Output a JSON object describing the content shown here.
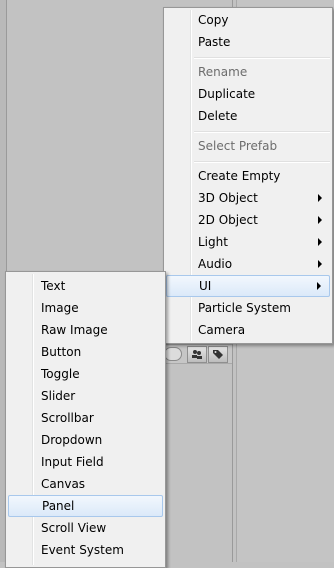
{
  "context_menu": {
    "items": [
      {
        "label": "Copy",
        "enabled": true
      },
      {
        "label": "Paste",
        "enabled": true
      },
      {
        "label": "Rename",
        "enabled": false
      },
      {
        "label": "Duplicate",
        "enabled": true
      },
      {
        "label": "Delete",
        "enabled": true
      },
      {
        "label": "Select Prefab",
        "enabled": false
      },
      {
        "label": "Create Empty",
        "enabled": true
      },
      {
        "label": "3D Object",
        "enabled": true,
        "has_submenu": true
      },
      {
        "label": "2D Object",
        "enabled": true,
        "has_submenu": true
      },
      {
        "label": "Light",
        "enabled": true,
        "has_submenu": true
      },
      {
        "label": "Audio",
        "enabled": true,
        "has_submenu": true
      },
      {
        "label": "UI",
        "enabled": true,
        "has_submenu": true,
        "highlighted": true
      },
      {
        "label": "Particle System",
        "enabled": true
      },
      {
        "label": "Camera",
        "enabled": true
      }
    ]
  },
  "ui_submenu": {
    "items": [
      {
        "label": "Text"
      },
      {
        "label": "Image"
      },
      {
        "label": "Raw Image"
      },
      {
        "label": "Button"
      },
      {
        "label": "Toggle"
      },
      {
        "label": "Slider"
      },
      {
        "label": "Scrollbar"
      },
      {
        "label": "Dropdown"
      },
      {
        "label": "Input Field"
      },
      {
        "label": "Canvas"
      },
      {
        "label": "Panel",
        "highlighted": true
      },
      {
        "label": "Scroll View"
      },
      {
        "label": "Event System"
      }
    ]
  },
  "toolbar_icons": [
    "search-icon",
    "users-icon",
    "tag-icon"
  ],
  "colors": {
    "menu_bg": "#f0f0f0",
    "highlight_border": "#a8c8ec",
    "disabled_text": "#6d6d6d"
  }
}
